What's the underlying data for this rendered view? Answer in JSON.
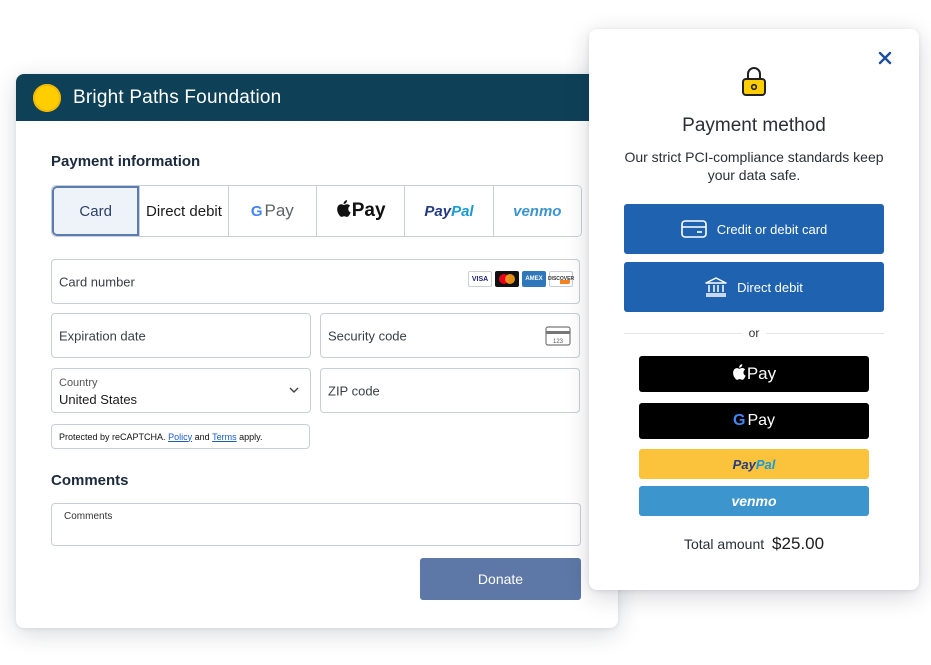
{
  "org": {
    "name": "Bright Paths Foundation",
    "logo_color": "#ffcd00",
    "header_color": "#0e4157"
  },
  "form": {
    "payment_title": "Payment information",
    "tabs": [
      {
        "id": "card",
        "label": "Card",
        "active": true
      },
      {
        "id": "direct-debit",
        "label": "Direct debit"
      },
      {
        "id": "google-pay",
        "label": "Pay",
        "icon": "google-g-icon"
      },
      {
        "id": "apple-pay",
        "label": "Pay",
        "icon": "apple-icon"
      },
      {
        "id": "paypal",
        "label_a": "Pay",
        "label_b": "Pal"
      },
      {
        "id": "venmo",
        "label": "venmo"
      }
    ],
    "card_number_label": "Card number",
    "card_brands": {
      "visa": "VISA",
      "amex": "AMEX",
      "discover": "DISCOVER"
    },
    "expiration_label": "Expiration date",
    "security_label": "Security code",
    "cvc_icon_text": "123",
    "country_label": "Country",
    "country_value": "United States",
    "zip_label": "ZIP code",
    "recaptcha_prefix": "Protected by reCAPTCHA.",
    "recaptcha_policy": "Policy",
    "recaptcha_and": "and",
    "recaptcha_terms": "Terms",
    "recaptcha_suffix": "apply.",
    "comments_title": "Comments",
    "comments_placeholder": "Comments",
    "donate_label": "Donate",
    "donate_color": "#5d78a6"
  },
  "panel": {
    "title": "Payment method",
    "subtitle": "Our strict PCI-compliance standards keep your data safe.",
    "credit_card_label": "Credit or debit card",
    "direct_debit_label": "Direct debit",
    "or_label": "or",
    "apple_pay_label": "Pay",
    "google_pay_g": "G",
    "google_pay_label": "Pay",
    "paypal_a": "Pay",
    "paypal_b": "Pal",
    "venmo_label": "venmo",
    "total_label": "Total amount",
    "total_value": "$25.00",
    "primary_color": "#1f62b0",
    "paypal_color": "#fbc23b",
    "venmo_color": "#3d95ce",
    "icons": [
      "lock-icon",
      "close-icon",
      "credit-card-icon",
      "bank-icon"
    ]
  }
}
